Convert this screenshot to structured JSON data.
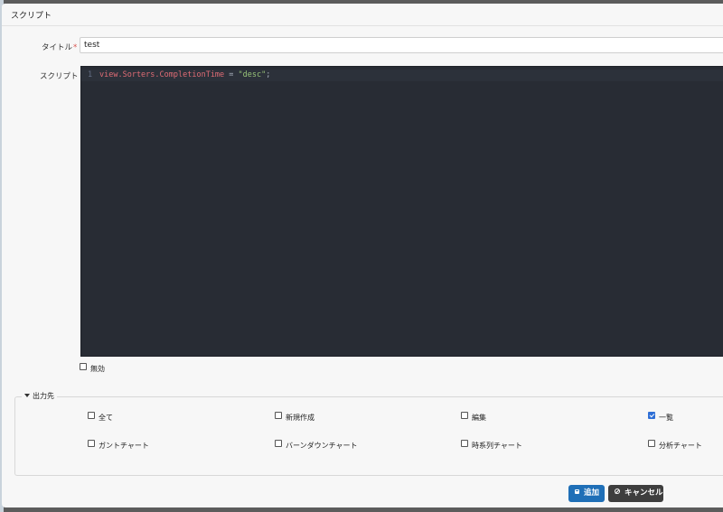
{
  "dialog": {
    "title": "スクリプト"
  },
  "form": {
    "title_label": "タイトル",
    "required_mark": "*",
    "title_value": "test",
    "script_label": "スクリプト",
    "editor": {
      "line_number": "1",
      "code_tokens": [
        {
          "text": "view.Sorters.CompletionTime",
          "type": "var"
        },
        {
          "text": " = ",
          "type": "punct"
        },
        {
          "text": "\"desc\"",
          "type": "string"
        },
        {
          "text": ";",
          "type": "punct"
        }
      ]
    },
    "disabled_label": "無効",
    "disabled_checked": false
  },
  "output": {
    "legend": "出力先",
    "options": [
      {
        "label": "全て",
        "checked": false
      },
      {
        "label": "新規作成",
        "checked": false
      },
      {
        "label": "編集",
        "checked": false
      },
      {
        "label": "一覧",
        "checked": true
      },
      {
        "label": "ガントチャート",
        "checked": false
      },
      {
        "label": "バーンダウンチャート",
        "checked": false
      },
      {
        "label": "時系列チャート",
        "checked": false
      },
      {
        "label": "分析チャート",
        "checked": false
      }
    ]
  },
  "buttons": {
    "add_label": "追加",
    "add_icon": "save-icon",
    "cancel_label": "キャンセル",
    "cancel_icon": "ban-icon",
    "add_color": "#1f6fb7",
    "cancel_color": "#3e3e3e"
  },
  "colors": {
    "editor_bg": "#282c34",
    "checkbox_checked": "#2f6fd6",
    "required": "#d9534f"
  }
}
